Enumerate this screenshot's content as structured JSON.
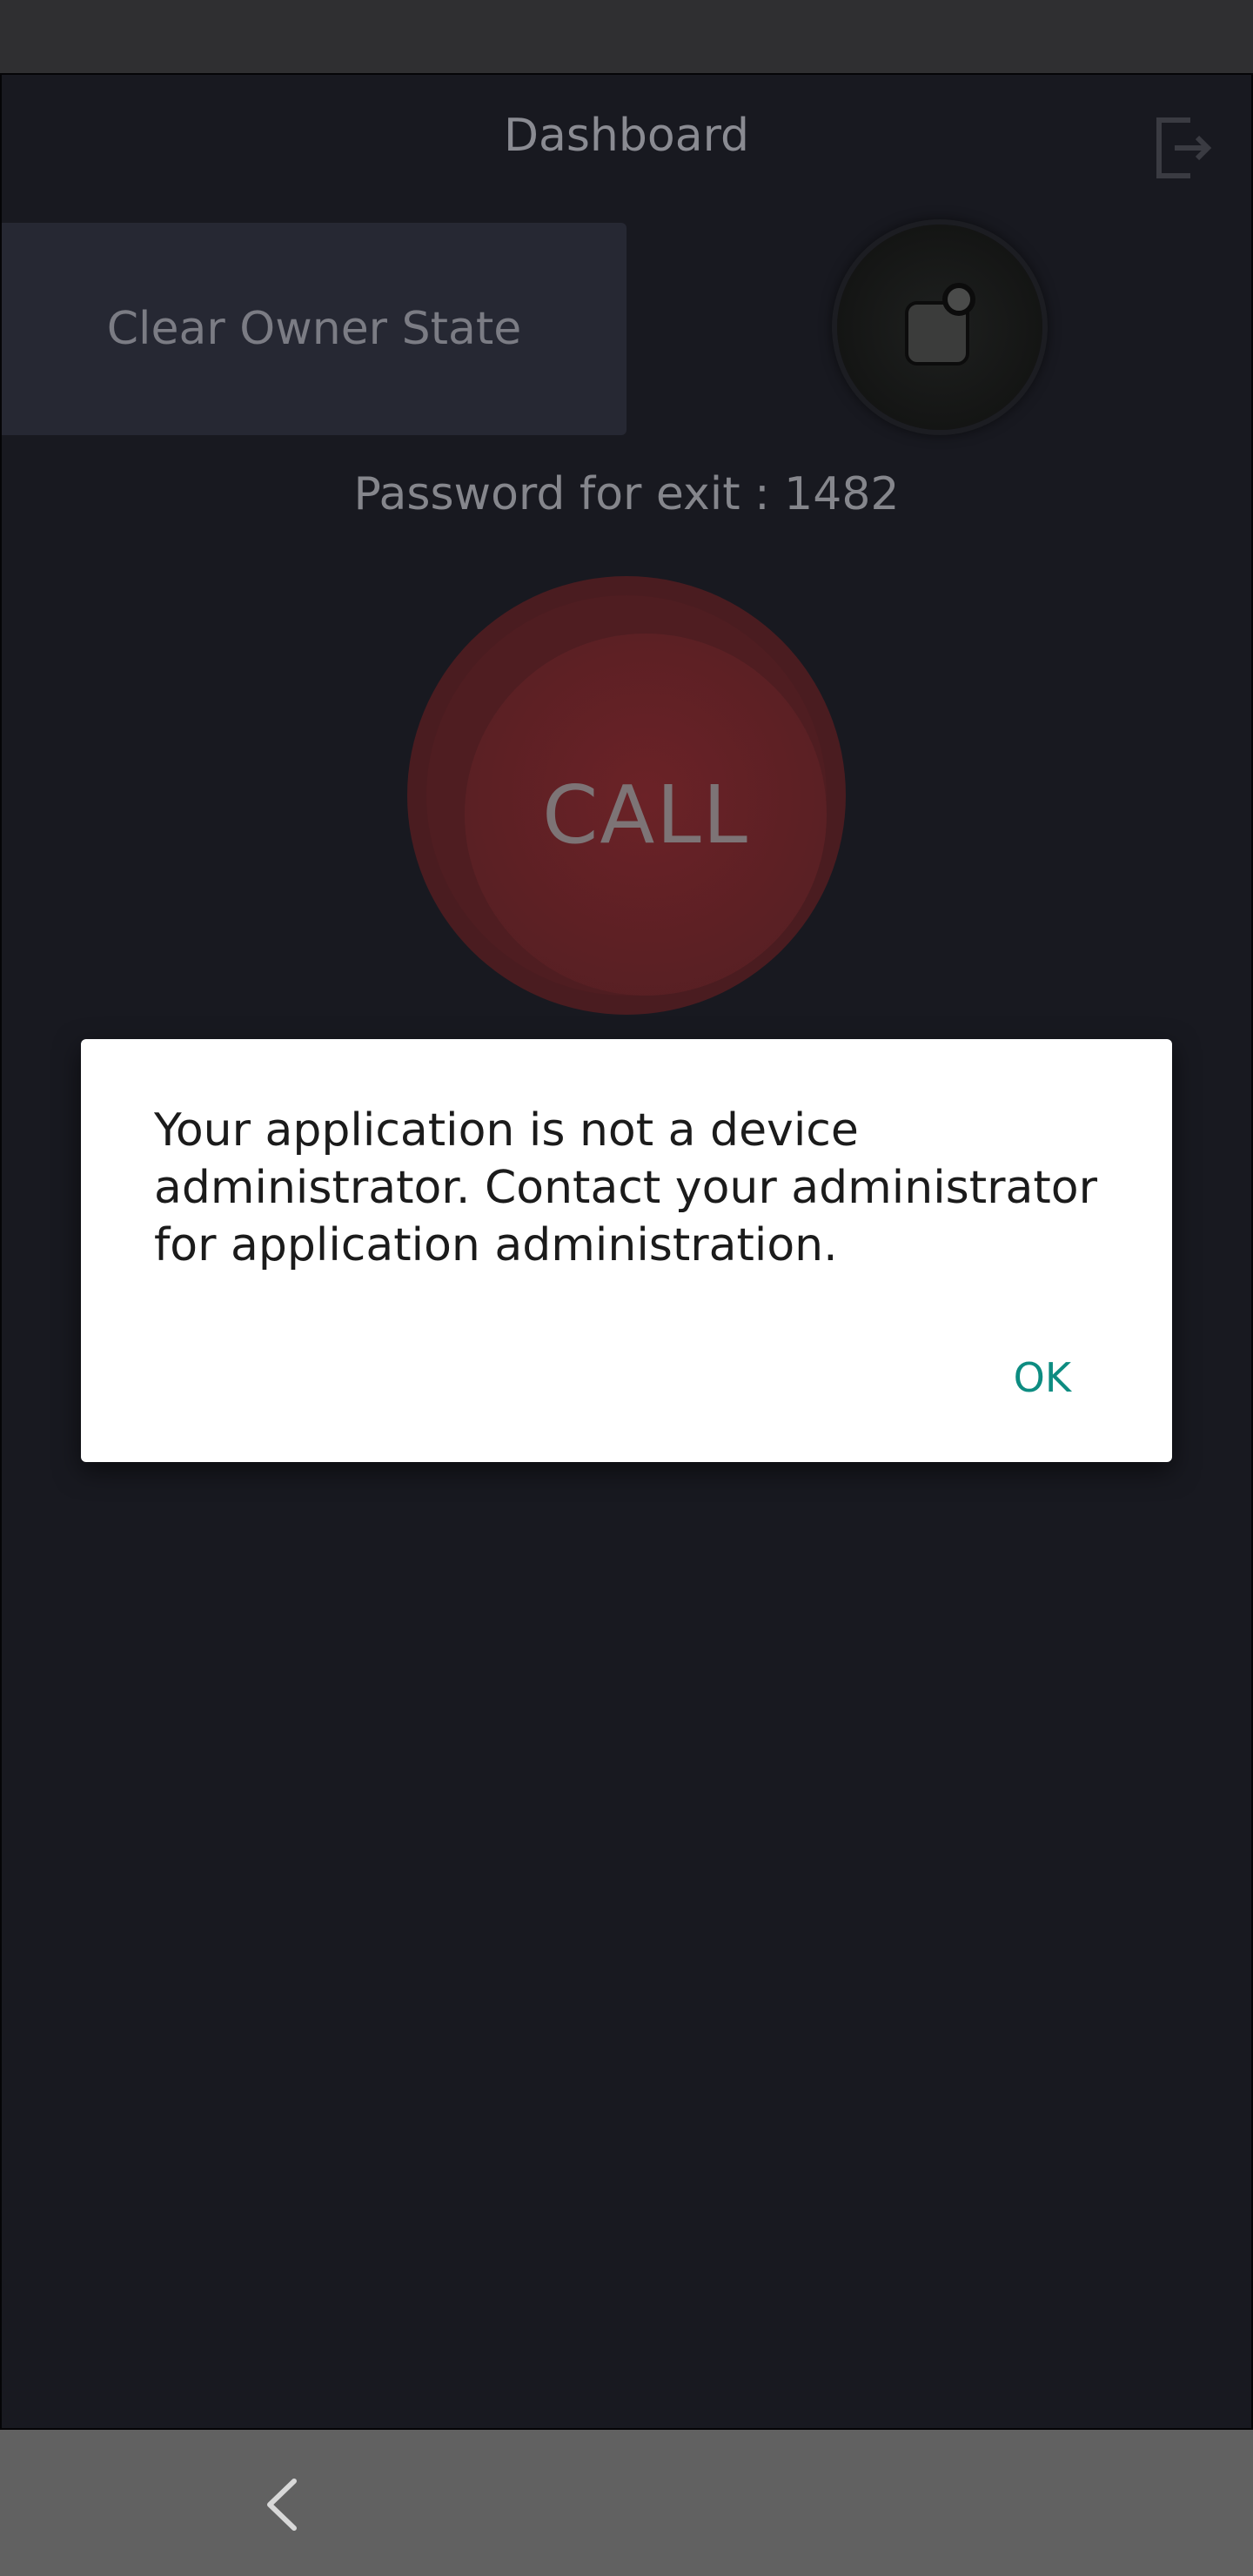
{
  "header": {
    "title": "Dashboard",
    "exit_icon": "exit-to-app-icon"
  },
  "controls": {
    "clear_owner_label": "Clear Owner State",
    "camera_icon": "camera-notification-icon"
  },
  "info": {
    "password_text": "Password for exit : 1482"
  },
  "call": {
    "label": "CALL",
    "color": "#5c2024"
  },
  "dialog": {
    "message": "Your application is not a device administrator. Contact your administrator for application administration.",
    "ok_label": "OK",
    "accent_color": "#0d8c81"
  },
  "navigation": {
    "back_icon": "chevron-left-icon"
  }
}
